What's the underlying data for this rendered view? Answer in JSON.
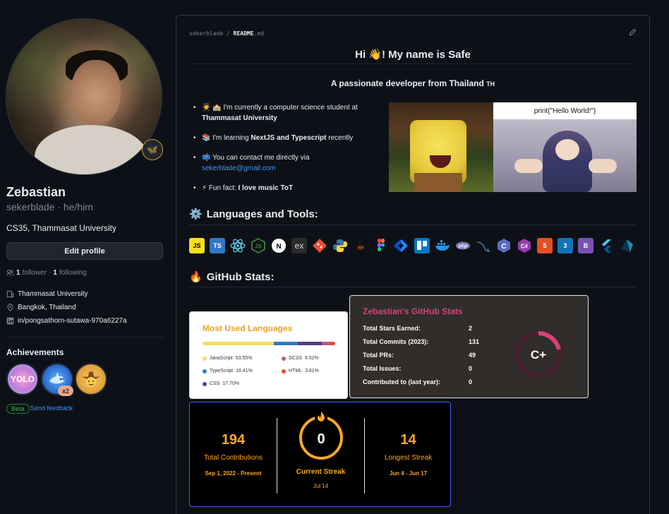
{
  "profile": {
    "name": "Zebastian",
    "login": "sekerblade · he/him",
    "bio": "CS35, Thammasat University",
    "edit_profile": "Edit profile",
    "followers_count": "1",
    "followers_label": "follower",
    "following_count": "1",
    "following_label": "following",
    "separator": "·",
    "organization": "Thammasat University",
    "location": "Bangkok, Thailand",
    "linkedin": "in/pongsathorn-sutawa-970a6227a",
    "status_emoji": "🦋"
  },
  "achievements": {
    "title": "Achievements",
    "badges": [
      "YOLO",
      "Pull Shark",
      "Quickdraw"
    ],
    "badge_count": "x2",
    "beta": "Beta",
    "feedback": "Send feedback"
  },
  "readme": {
    "owner": "sekerblade",
    "sep": "/",
    "file": "README",
    "ext": ".md",
    "heading": "Hi 👋! My name is Safe",
    "subheading": "A passionate developer from Thailand",
    "flag_text": "TH",
    "bullets": [
      {
        "prefix": "🧑‍🎓 🏫 I'm currently a computer science student at ",
        "bold": "Thammasat University"
      },
      {
        "prefix": "📚 I'm learning ",
        "bold": "NextJS and Typescript",
        "suffix": " recently"
      },
      {
        "prefix": "📫 You can contact me directly via ",
        "link": "sekerblade@gmail.com"
      },
      {
        "prefix": "⚡ Fun fact: ",
        "bold": "I love music ToT"
      }
    ],
    "gif_caption": "print(\"Hello World!\")",
    "languages_heading": "Languages and Tools:",
    "stats_heading": "GitHub Stats:",
    "tools": [
      "JS",
      "TS",
      "React",
      "Node",
      "Next",
      "Express",
      "Git",
      "Python",
      "Java",
      "Figma",
      "Jira",
      "Trello",
      "Docker",
      "PHP",
      "MySQL",
      "C",
      "C#",
      "HTML5",
      "CSS3",
      "Bootstrap",
      "Flutter",
      "Prisma"
    ]
  },
  "most_used_languages": {
    "title": "Most Used Languages",
    "items": [
      {
        "name": "JavaScript",
        "percent": "53.55%",
        "color": "#f1e05a"
      },
      {
        "name": "SCSS",
        "percent": "6.52%",
        "color": "#c6538c"
      },
      {
        "name": "TypeScript",
        "percent": "18.41%",
        "color": "#3178c6"
      },
      {
        "name": "HTML",
        "percent": "3.81%",
        "color": "#e34c26"
      },
      {
        "name": "CSS",
        "percent": "17.70%",
        "color": "#563d7c"
      }
    ]
  },
  "github_stats": {
    "title": "Zebastian's GitHub Stats",
    "rows": [
      {
        "label": "Total Stars Earned:",
        "value": "2"
      },
      {
        "label": "Total Commits (2023):",
        "value": "131"
      },
      {
        "label": "Total PRs:",
        "value": "49"
      },
      {
        "label": "Total Issues:",
        "value": "0"
      },
      {
        "label": "Contributed to (last year):",
        "value": "0"
      }
    ],
    "rank": "C+"
  },
  "streak": {
    "total": "194",
    "total_label": "Total Contributions",
    "total_range": "Sep 1, 2022 - Present",
    "current": "0",
    "current_label": "Current Streak",
    "current_date": "Jul 14",
    "longest": "14",
    "longest_label": "Longest Streak",
    "longest_range": "Jun 4 - Jun 17"
  }
}
